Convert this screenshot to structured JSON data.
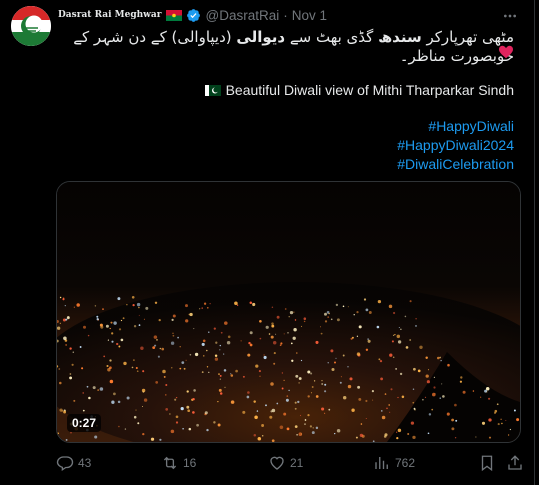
{
  "tweet": {
    "display_name": "Dasrat Rai  Meghwar",
    "handle": "@DasratRai",
    "separator": "·",
    "date": "Nov 1",
    "urdu_text_1": "مٹھی تھرپارکر ",
    "urdu_bold_1": "سندھ",
    "urdu_text_2": " گڈی بھٹ سے ",
    "urdu_bold_2": "دیوالی",
    "urdu_text_3": " (دیپاوالی) کے دن شہر کے خوبصورت مناظر۔",
    "english_text": "Beautiful Diwali view of Mithi Tharparkar Sindh",
    "hashtags": [
      "#HappyDiwali",
      "#HappyDiwali2024",
      "#DiwaliCelebration"
    ]
  },
  "video": {
    "duration": "0:27"
  },
  "actions": {
    "replies": "43",
    "reposts": "16",
    "likes": "21",
    "views": "762"
  },
  "colors": {
    "link": "#1d9bf0",
    "muted": "#71767b",
    "verified": "#1d9bf0",
    "heart": "#e0245e"
  }
}
